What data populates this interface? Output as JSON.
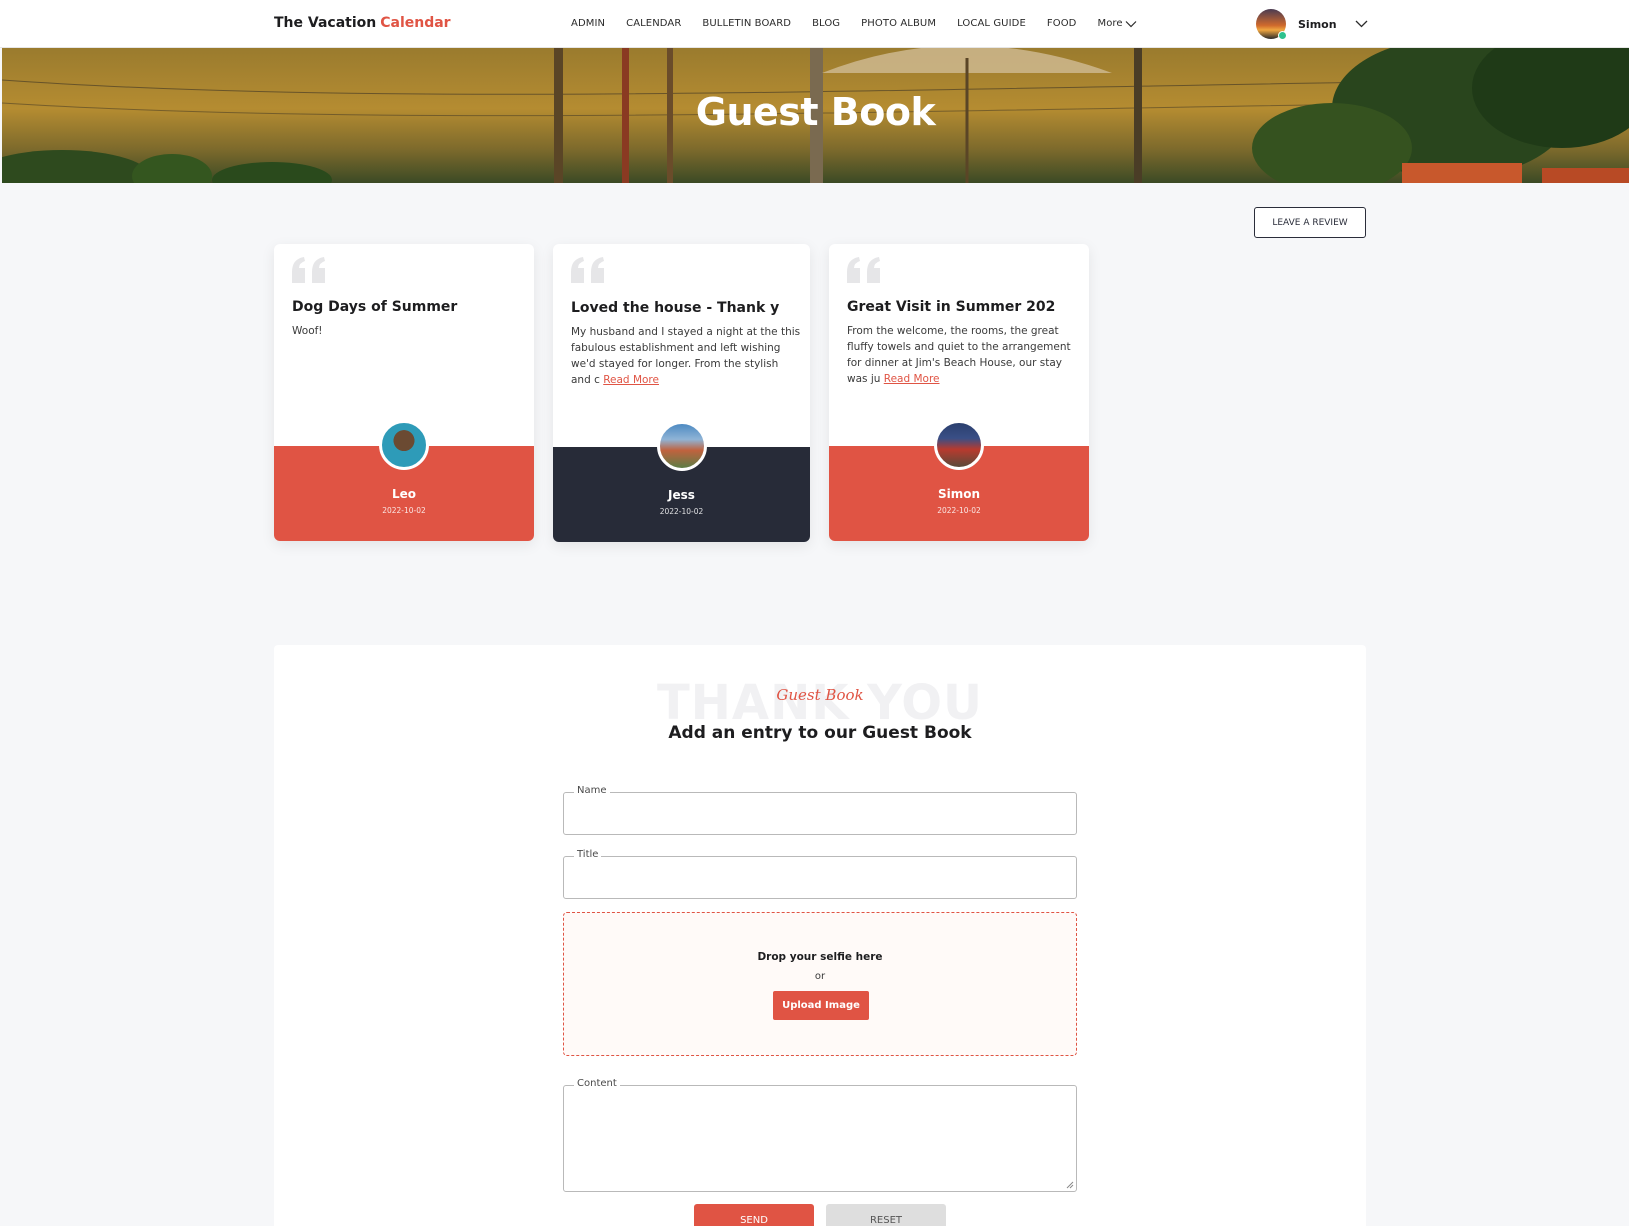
{
  "brand": {
    "name": "The Vacation",
    "accent": "Calendar"
  },
  "nav": {
    "items": [
      "ADMIN",
      "CALENDAR",
      "BULLETIN BOARD",
      "BLOG",
      "PHOTO ALBUM",
      "LOCAL GUIDE",
      "FOOD"
    ],
    "more_label": "More"
  },
  "user": {
    "name": "Simon"
  },
  "hero": {
    "title": "Guest Book"
  },
  "actions": {
    "leave_review": "LEAVE A REVIEW"
  },
  "reviews": [
    {
      "title": "Dog Days of Summer",
      "text": "Woof!",
      "read_more": "",
      "author": "Leo",
      "date": "2022-10-02",
      "footer_color": "#e05444"
    },
    {
      "title": "Loved the house - Thank y",
      "text": "My husband and I stayed a night at the this fabulous establishment and left wishing we'd stayed for longer. From the stylish and c",
      "read_more": "Read More",
      "author": "Jess",
      "date": "2022-10-02",
      "footer_color": "#272b38"
    },
    {
      "title": "Great Visit in Summer 202",
      "text": "From the welcome, the rooms, the great fluffy towels and quiet to the arrangement for dinner at Jim's Beach House, our stay was ju",
      "read_more": "Read More",
      "author": "Simon",
      "date": "2022-10-02",
      "footer_color": "#e05444"
    }
  ],
  "form": {
    "bg_word": "THANK YOU",
    "script_label": "Guest Book",
    "heading": "Add an entry to our Guest Book",
    "name_label": "Name",
    "title_label": "Title",
    "dropzone_title": "Drop your selfie here",
    "dropzone_or": "or",
    "upload_label": "Upload Image",
    "content_label": "Content",
    "send_label": "SEND",
    "reset_label": "RESET"
  },
  "colors": {
    "accent": "#e05444",
    "dark": "#272b38",
    "online": "#2ec28e"
  }
}
